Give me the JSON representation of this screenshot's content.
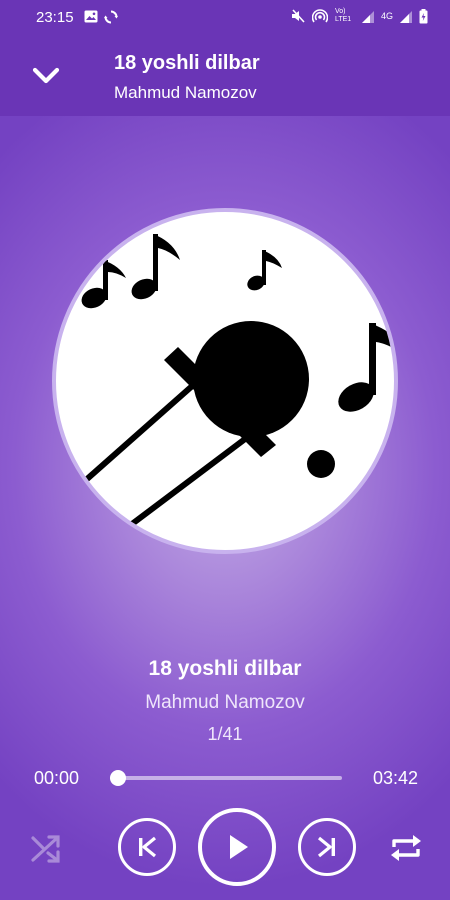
{
  "status_bar": {
    "time": "23:15",
    "left_icons": [
      "image-icon",
      "sync-icon"
    ],
    "right_icons": [
      "mute-icon",
      "hotspot-icon",
      "volte-icon",
      "signal-icon",
      "data-4g-icon",
      "signal-icon",
      "battery-icon"
    ],
    "volte_label": "Vo) LTE1",
    "net_label": "4G"
  },
  "header": {
    "collapse_icon": "chevron-down-icon",
    "title": "18 yoshli dilbar",
    "artist": "Mahmud Namozov"
  },
  "album_art": {
    "icon": "karaoke-microphone-icon"
  },
  "now_playing": {
    "title": "18 yoshli dilbar",
    "artist": "Mahmud Namozov",
    "track_position": "1/41"
  },
  "progress": {
    "elapsed": "00:00",
    "total": "03:42",
    "fraction": 0.0
  },
  "controls": {
    "shuffle_icon": "shuffle-icon",
    "shuffle_active": false,
    "previous_icon": "skip-previous-icon",
    "play_icon": "play-icon",
    "next_icon": "skip-next-icon",
    "repeat_icon": "repeat-icon",
    "repeat_active": true
  },
  "colors": {
    "primary": "#6a35b6",
    "background_center": "#c3ace6",
    "on_primary": "#ffffff",
    "disabled": "#a98ad8"
  }
}
